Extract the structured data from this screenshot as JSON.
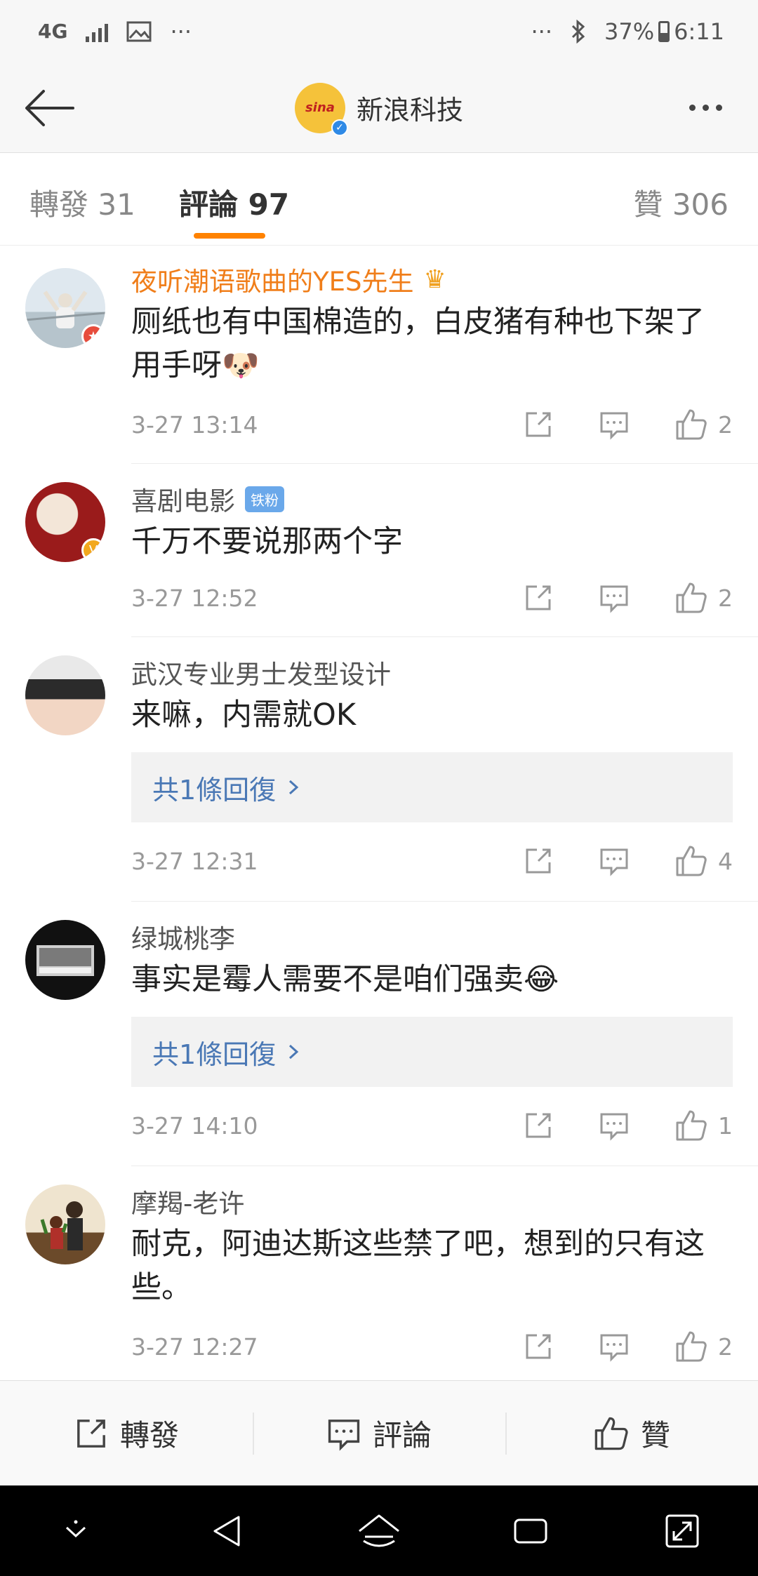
{
  "status_bar": {
    "network": "4G",
    "more_left": "···",
    "more_right": "···",
    "battery_percent": "37%",
    "time": "6:11"
  },
  "header": {
    "logo_text": "sina",
    "title": "新浪科技"
  },
  "tabs": {
    "repost": "轉發 31",
    "comments": "評論 97",
    "likes": "贊 306"
  },
  "comments": [
    {
      "name": "夜听潮语歌曲的YES先生",
      "text": "厕纸也有中国棉造的，白皮猪有种也下架了用手呀🐶",
      "time": "3-27 13:14",
      "likes": "2"
    },
    {
      "name": "喜剧电影",
      "badge": "铁粉",
      "text": "千万不要说那两个字",
      "time": "3-27 12:52",
      "likes": "2"
    },
    {
      "name": "武汉专业男士发型设计",
      "text": "来嘛，内需就OK",
      "reply": "共1條回復",
      "time": "3-27 12:31",
      "likes": "4"
    },
    {
      "name": "绿城桃李",
      "text": "事实是霉人需要不是咱们强卖😂",
      "reply": "共1條回復",
      "time": "3-27 14:10",
      "likes": "1"
    },
    {
      "name": "摩羯-老许",
      "text": "耐克，阿迪达斯这些禁了吧，想到的只有这些。",
      "time": "3-27 12:27",
      "likes": "2"
    }
  ],
  "toolbar": {
    "repost": "轉發",
    "comment": "評論",
    "like": "贊"
  }
}
